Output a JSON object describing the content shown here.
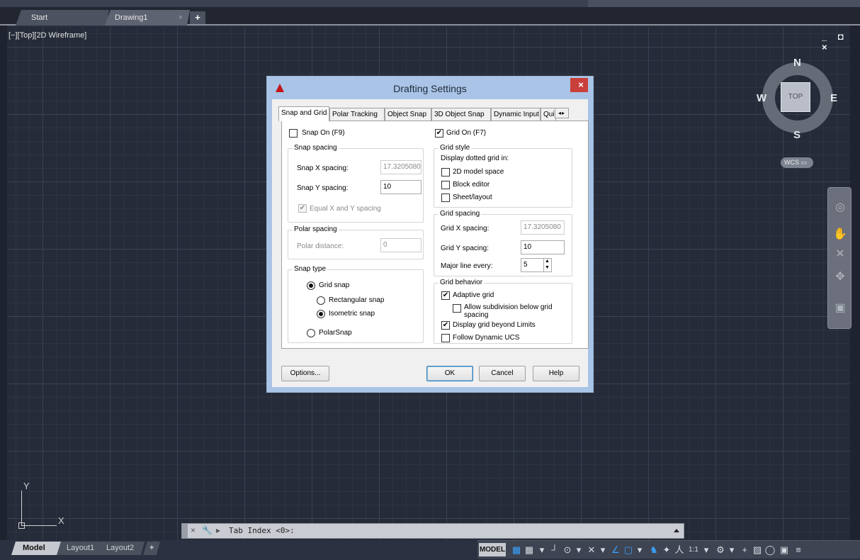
{
  "file_tabs": {
    "start": "Start",
    "drawing": "Drawing1",
    "close": "×",
    "add": "+"
  },
  "viewport": {
    "label": "[−][Top][2D Wireframe]",
    "controls": "_ ◘ ×"
  },
  "viewcube": {
    "north": "N",
    "south": "S",
    "west": "W",
    "east": "E",
    "top": "TOP",
    "wcs": "WCS ▭"
  },
  "ucs": {
    "x": "X",
    "y": "Y"
  },
  "command_line": {
    "prompt": "Tab Index <0>:",
    "close_icon": "×",
    "settings_icon": "🔧",
    "prompt_icon": "▸"
  },
  "layout_tabs": {
    "model": "Model",
    "layout1": "Layout1",
    "layout2": "Layout2",
    "add": "+"
  },
  "statusbar": {
    "model": "MODEL",
    "icons": [
      "▦",
      "▾",
      "┘",
      "⊙",
      "▾",
      "✕",
      "▾",
      "∠",
      "▢",
      "▾",
      "♞",
      "✦",
      "人",
      "1:1",
      "▾",
      "⚙",
      "▾",
      "+",
      "▨",
      "◯",
      "▣",
      "≡"
    ]
  },
  "dialog": {
    "title": "Drafting Settings",
    "close": "×",
    "tabs": [
      "Snap and Grid",
      "Polar Tracking",
      "Object Snap",
      "3D Object Snap",
      "Dynamic Input",
      "Quic"
    ],
    "tab_scroll": "◂▸",
    "snap_on": {
      "label": "Snap On (F9)",
      "checked": false
    },
    "grid_on": {
      "label": "Grid On (F7)",
      "checked": true
    },
    "snap_spacing": {
      "title": "Snap spacing",
      "x_label": "Snap X spacing:",
      "x_value": "17.3205080",
      "y_label": "Snap Y spacing:",
      "y_value": "10",
      "equal_label": "Equal X and Y spacing"
    },
    "polar_spacing": {
      "title": "Polar spacing",
      "distance_label": "Polar distance:",
      "distance_value": "0"
    },
    "snap_type": {
      "title": "Snap type",
      "grid_snap": "Grid snap",
      "rectangular": "Rectangular snap",
      "isometric": "Isometric snap",
      "polar": "PolarSnap"
    },
    "grid_style": {
      "title": "Grid style",
      "caption": "Display dotted grid in:",
      "model": "2D model space",
      "block": "Block editor",
      "sheet": "Sheet/layout"
    },
    "grid_spacing": {
      "title": "Grid spacing",
      "x_label": "Grid X spacing:",
      "x_value": "17.3205080",
      "y_label": "Grid Y spacing:",
      "y_value": "10",
      "major_label": "Major line every:",
      "major_value": "5"
    },
    "grid_behavior": {
      "title": "Grid behavior",
      "adaptive": "Adaptive grid",
      "subdivision_line1": "Allow subdivision below grid",
      "subdivision_line2": "spacing",
      "beyond": "Display grid beyond Limits",
      "dynamic": "Follow Dynamic UCS"
    },
    "buttons": {
      "options": "Options...",
      "ok": "OK",
      "cancel": "Cancel",
      "help": "Help"
    },
    "check_mark": "✔"
  }
}
